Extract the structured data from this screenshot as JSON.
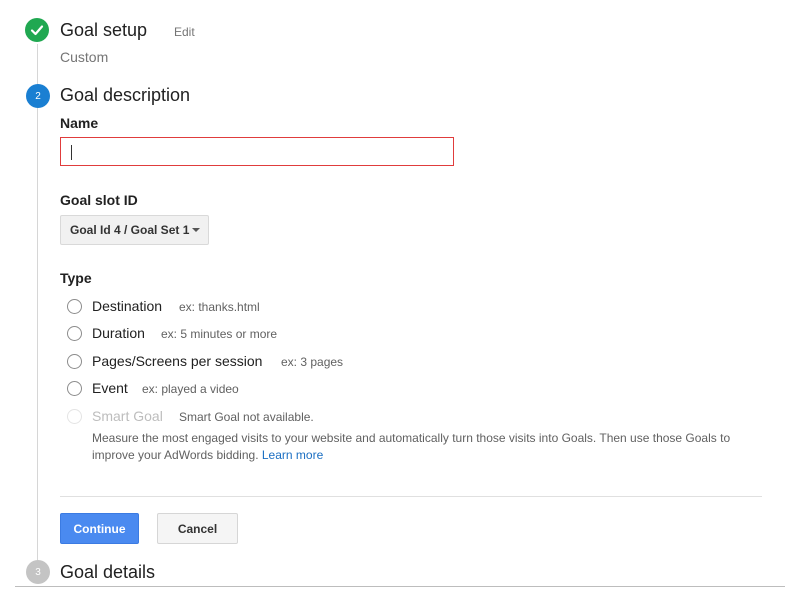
{
  "steps": {
    "setup": {
      "number": "1",
      "title": "Goal setup",
      "edit_label": "Edit",
      "subtitle": "Custom"
    },
    "description": {
      "number": "2",
      "title": "Goal description"
    },
    "details": {
      "number": "3",
      "title": "Goal details"
    }
  },
  "form": {
    "name_label": "Name",
    "name_value": "",
    "slot_label": "Goal slot ID",
    "slot_value": "Goal Id 4 / Goal Set 1",
    "type_label": "Type",
    "type_options": [
      {
        "label": "Destination",
        "hint": "ex: thanks.html"
      },
      {
        "label": "Duration",
        "hint": "ex: 5 minutes or more"
      },
      {
        "label": "Pages/Screens per session",
        "hint": "ex: 3 pages"
      },
      {
        "label": "Event",
        "hint": "ex: played a video"
      },
      {
        "label": "Smart Goal",
        "hint": "Smart Goal not available."
      }
    ],
    "smart_goal_desc": "Measure the most engaged visits to your website and automatically turn those visits into Goals. Then use those Goals to improve your AdWords bidding.",
    "learn_more": "Learn more"
  },
  "buttons": {
    "continue": "Continue",
    "cancel": "Cancel"
  },
  "icons": {
    "done": "checkmark-icon",
    "dropdown": "caret-down-icon"
  },
  "colors": {
    "done": "#20a851",
    "active": "#1a7fd2",
    "pending": "#c4c4c4",
    "error_border": "#e03c3c",
    "primary_button": "#4a8af0",
    "link": "#1a6ec2"
  }
}
